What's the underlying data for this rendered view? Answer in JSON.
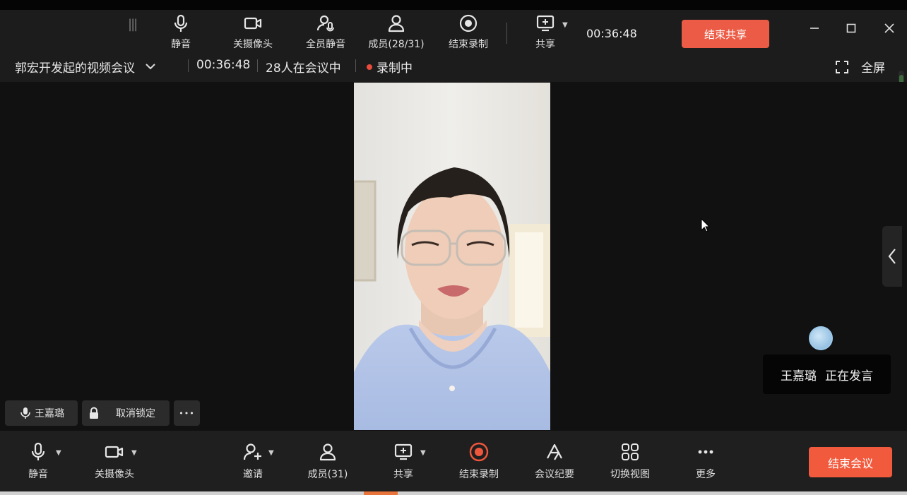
{
  "toolbar": {
    "mute": "静音",
    "camera_off": "关摄像头",
    "mute_all": "全员静音",
    "members": "成员(28/31)",
    "end_recording": "结束录制",
    "share": "共享",
    "timer": "00:36:48",
    "end_share": "结束共享"
  },
  "info": {
    "meeting_title": "郭宏开发起的视频会议",
    "elapsed": "00:36:48",
    "participants": "28人在会议中",
    "recording": "录制中",
    "fullscreen": "全屏"
  },
  "stage": {
    "active_speaker_name": "王嘉璐",
    "active_speaker_status": "正在发言",
    "chip_name": "王嘉璐",
    "unlock_label": "取消锁定",
    "more_glyph": "•••"
  },
  "bottom": {
    "mute": "静音",
    "camera_off": "关摄像头",
    "invite": "邀请",
    "members": "成员(31)",
    "share": "共享",
    "end_recording": "结束录制",
    "minutes": "会议纪要",
    "switch_view": "切换视图",
    "more": "更多",
    "end_meeting": "结束会议"
  },
  "colors": {
    "accent_red": "#f25a3d",
    "recording_dot": "#e94b3c",
    "record_icon": "#f0563c"
  },
  "icons": [
    "microphone-icon",
    "camera-icon",
    "mute-all-icon",
    "members-icon",
    "record-icon",
    "share-screen-icon",
    "invite-icon",
    "minutes-icon",
    "grid-view-icon",
    "more-icon",
    "lock-icon",
    "fullscreen-icon",
    "chevron-left-icon"
  ]
}
